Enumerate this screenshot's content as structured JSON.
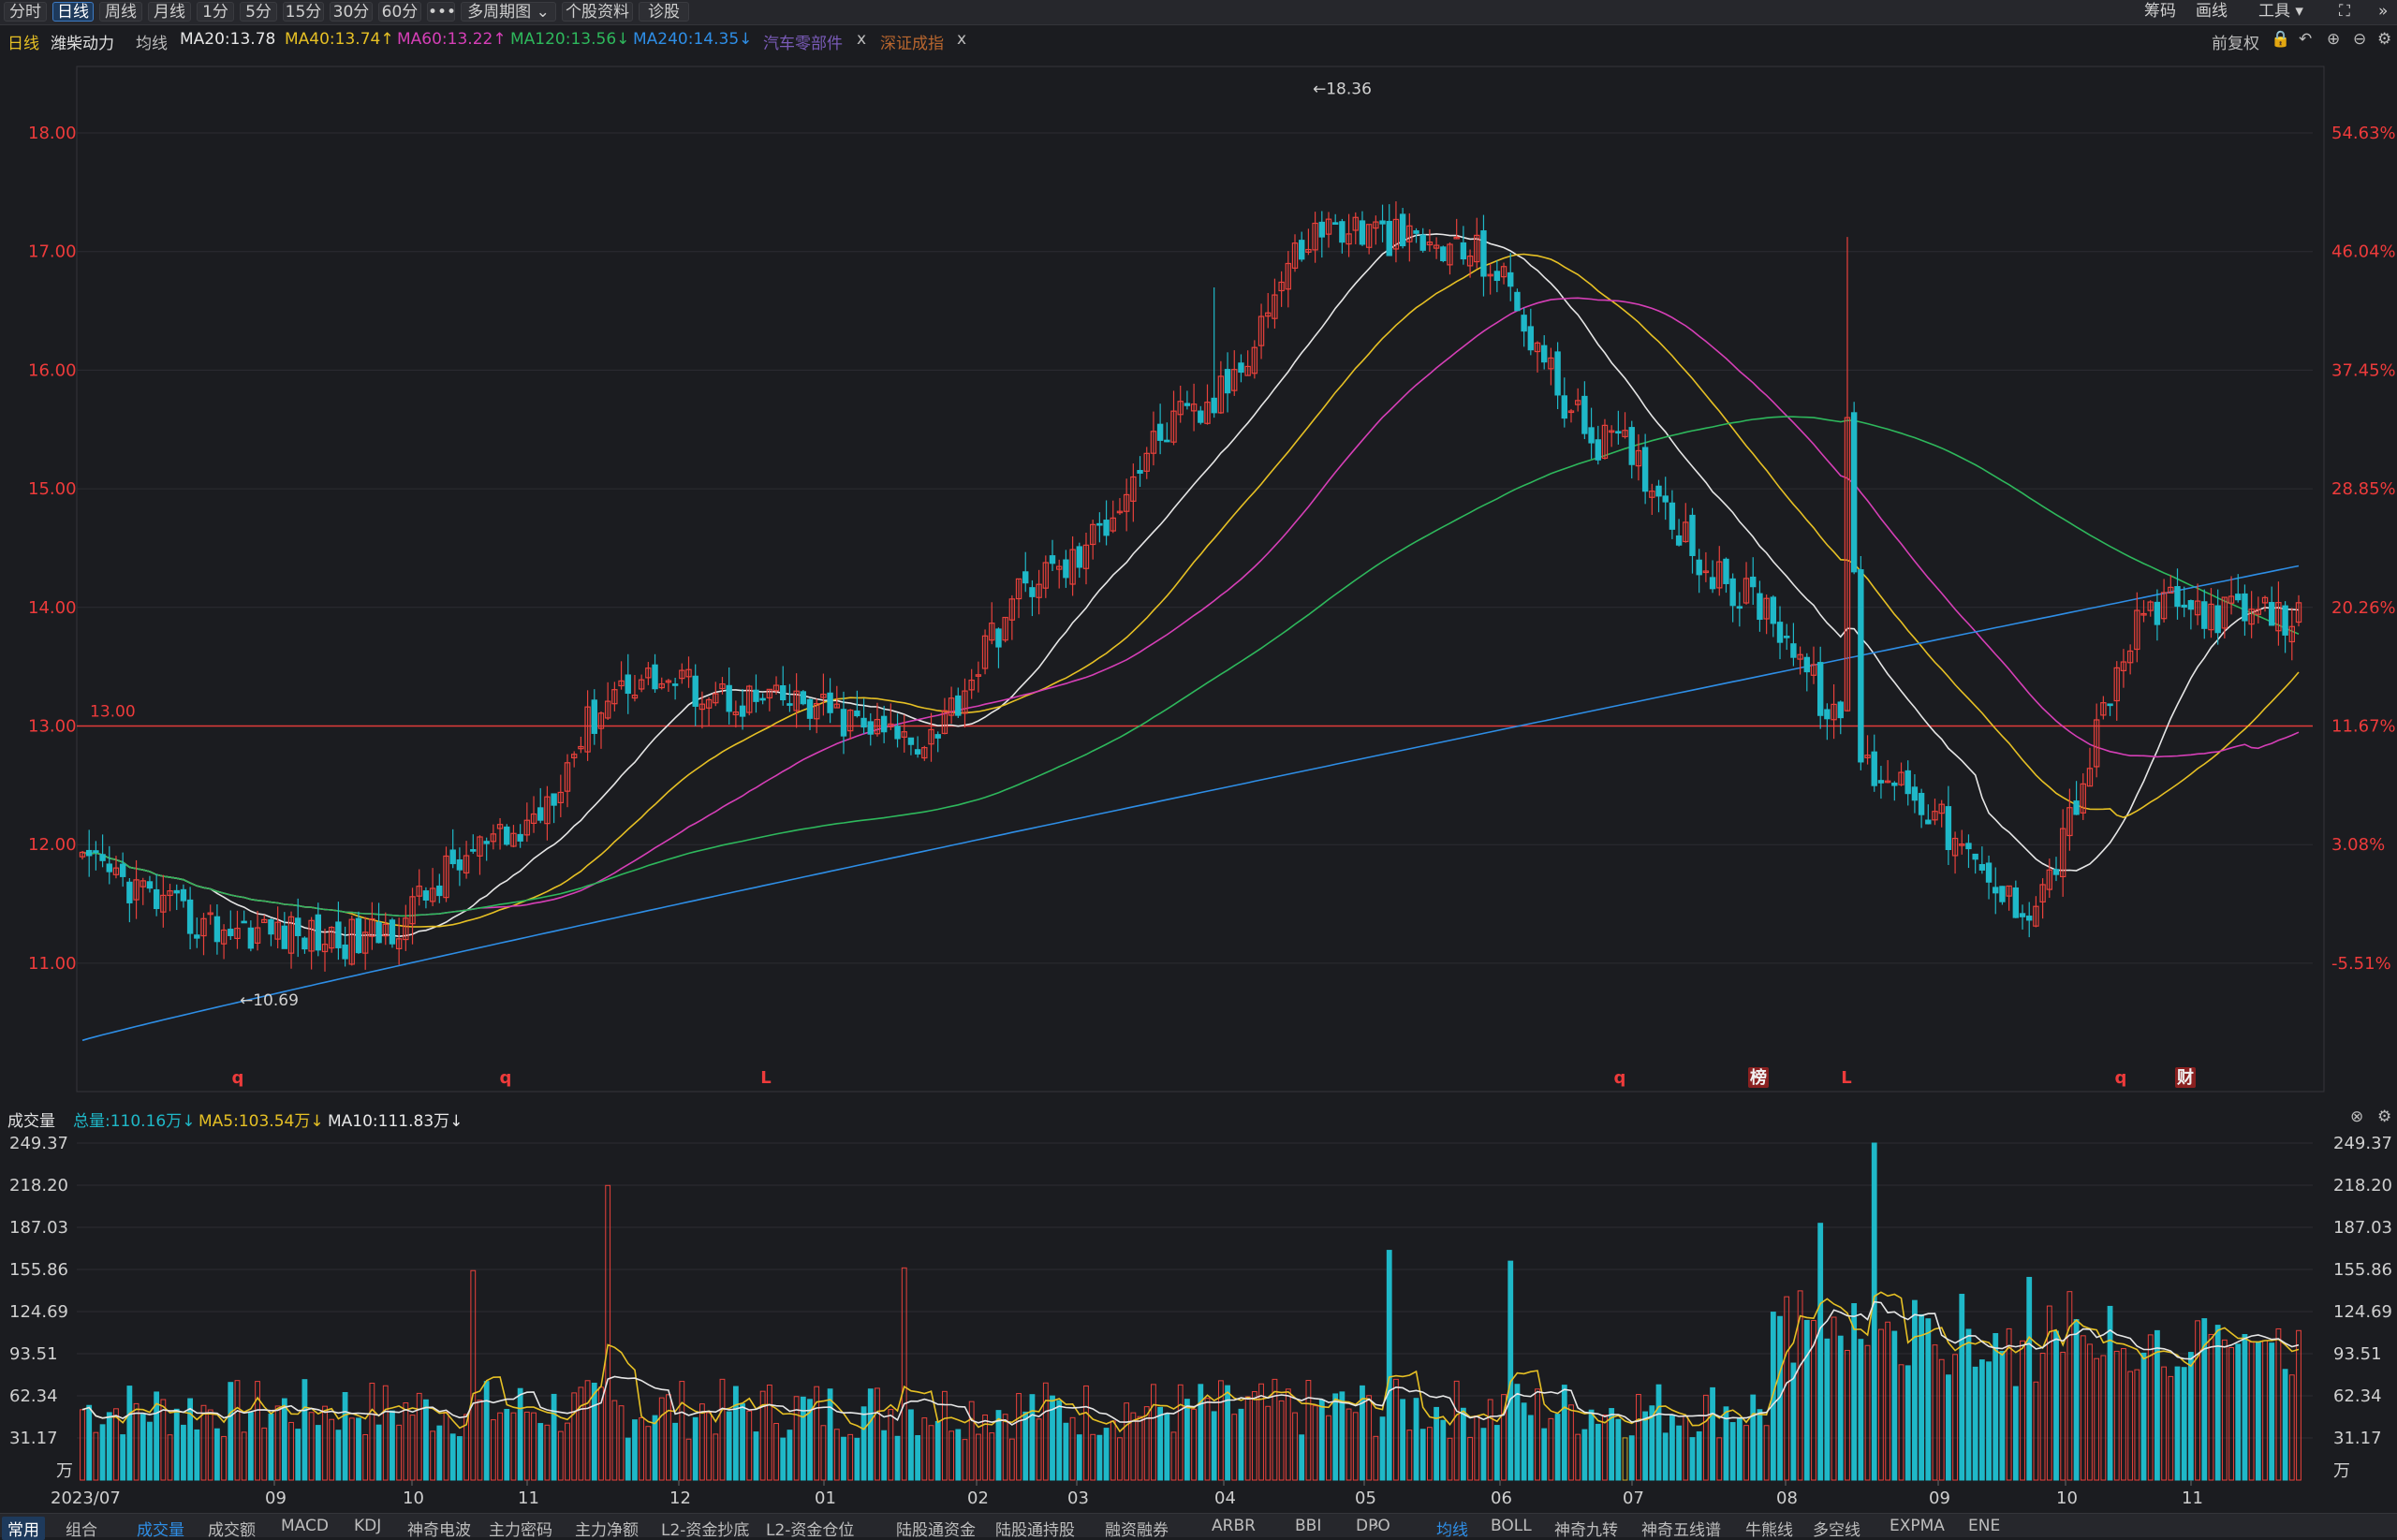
{
  "toolbar": {
    "periods": [
      "分时",
      "日线",
      "周线",
      "月线",
      "1分",
      "5分",
      "15分",
      "30分",
      "60分",
      "•••",
      "多周期图 ⌄",
      "个股资料",
      "诊股"
    ],
    "active_period": "日线",
    "right": [
      "筹码",
      "画线",
      "工具 ▾"
    ]
  },
  "info": {
    "period": "日线",
    "stock_name": "潍柴动力",
    "avg_label": "均线",
    "ma20": "MA20:13.78",
    "ma40": "MA40:13.74↑",
    "ma60": "MA60:13.22↑",
    "ma120": "MA120:13.56↓",
    "ma240": "MA240:14.35↓",
    "sector1": "汽车零部件",
    "sector2": "深证成指",
    "close_x": "x",
    "adjust": "前复权"
  },
  "colors": {
    "up": "#e8413b",
    "down": "#1fb8c8",
    "ma20": "#e6e6e6",
    "ma40": "#e6c024",
    "ma60": "#d63fb7",
    "ma120": "#2eb85c",
    "ma240": "#2e8ee6",
    "bg": "#1b1c20",
    "grid": "#2c2d32",
    "text_up": "#ee3b3b",
    "ref_line": "#e23b3b"
  },
  "chart_data": [
    {
      "type": "candlestick",
      "title": "潍柴动力 日线",
      "ylim": [
        10.3,
        18.6
      ],
      "y_ticks": [
        "18.00",
        "17.00",
        "16.00",
        "15.00",
        "14.00",
        "13.00",
        "12.00",
        "11.00"
      ],
      "pct_ticks": [
        "54.63%",
        "46.04%",
        "37.45%",
        "28.85%",
        "20.26%",
        "11.67%",
        "3.08%",
        "-5.51%"
      ],
      "x_labels": [
        "2023/07",
        "09",
        "10",
        "11",
        "12",
        "01",
        "02",
        "03",
        "04",
        "05",
        "06",
        "07",
        "08",
        "09",
        "10",
        "11"
      ],
      "ref_line_label": "13.00",
      "high_label": "←18.36",
      "low_label": "←10.69",
      "markers": [
        "q",
        "q",
        "L",
        "q",
        "榜",
        "L",
        "q",
        "财"
      ],
      "close_trend": [
        {
          "date": "2023/07",
          "close": 11.8
        },
        {
          "date": "08",
          "close": 11.3
        },
        {
          "date": "09",
          "close": 11.2
        },
        {
          "date": "10",
          "close": 12.0
        },
        {
          "date": "11",
          "close": 13.4
        },
        {
          "date": "12",
          "close": 13.2
        },
        {
          "date": "01",
          "close": 12.9
        },
        {
          "date": "02",
          "close": 14.3
        },
        {
          "date": "03",
          "close": 15.6
        },
        {
          "date": "04",
          "close": 17.2
        },
        {
          "date": "05",
          "close": 17.0
        },
        {
          "date": "06",
          "close": 15.4
        },
        {
          "date": "07",
          "close": 14.1
        },
        {
          "date": "08",
          "close": 12.6
        },
        {
          "date": "09",
          "close": 11.5
        },
        {
          "date": "10",
          "close": 14.0
        },
        {
          "date": "11",
          "close": 13.9
        }
      ]
    },
    {
      "type": "bar",
      "title": "成交量",
      "ylim": [
        0,
        249.37
      ],
      "y_ticks": [
        "249.37",
        "218.20",
        "187.03",
        "155.86",
        "124.69",
        "93.51",
        "62.34",
        "31.17",
        "万"
      ],
      "peaks": [
        {
          "date": "10",
          "value": 155
        },
        {
          "date": "11",
          "value": 218
        },
        {
          "date": "12",
          "value": 157
        },
        {
          "date": "05",
          "value": 170
        },
        {
          "date": "07",
          "value": 162
        },
        {
          "date": "10",
          "value": 249.37
        }
      ]
    }
  ],
  "volume_info": {
    "label": "成交量",
    "total": "总量:110.16万↓",
    "ma5": "MA5:103.54万↓",
    "ma10": "MA10:111.83万↓"
  },
  "bottom_tabs": {
    "left": [
      "常用",
      "组合"
    ],
    "indicators": [
      "成交量",
      "成交额",
      "MACD",
      "KDJ",
      "神奇电波",
      "主力密码",
      "主力净额",
      "L2-资金抄底",
      "L2-资金仓位",
      "陆股通资金",
      "陆股通持股",
      "融资融券",
      "ARBR",
      "BBI",
      "DPO"
    ],
    "right": [
      "均线",
      "BOLL",
      "神奇九转",
      "神奇五线谱",
      "牛熊线",
      "多空线",
      "EXPMA",
      "ENE"
    ]
  }
}
